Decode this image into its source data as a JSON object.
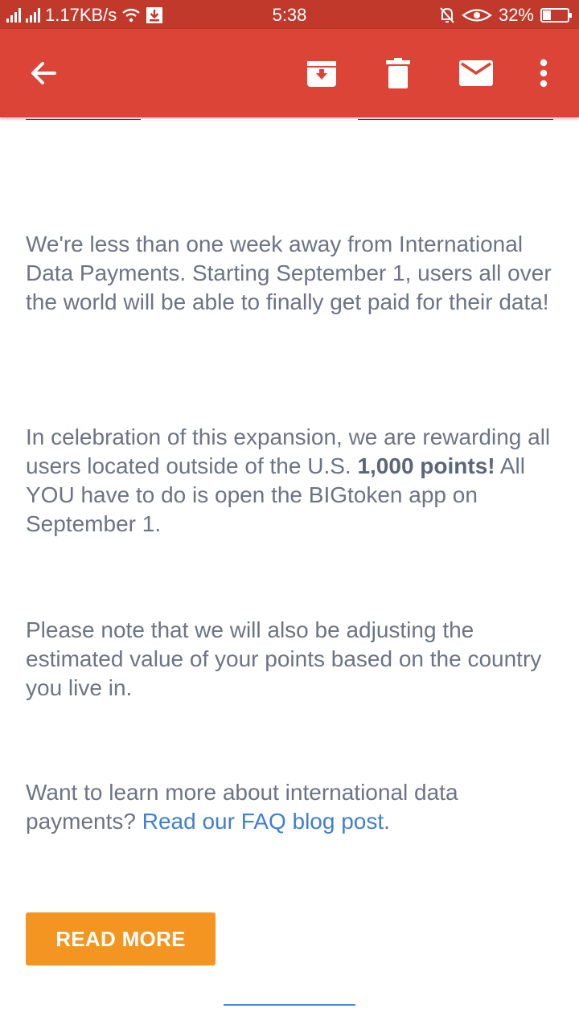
{
  "status_bar": {
    "network_speed": "1.17KB/s",
    "time": "5:38",
    "battery": "32%",
    "battery_level": 0.32,
    "icons": [
      "signal-icon",
      "signal-icon",
      "wifi-icon",
      "download-icon",
      "mute-icon",
      "eye-icon",
      "battery-icon"
    ]
  },
  "app_bar": {
    "color": "#db4437",
    "icons": [
      "back-arrow-icon",
      "archive-icon",
      "trash-icon",
      "mail-icon",
      "more-vert-icon"
    ]
  },
  "email": {
    "p1": "We're less than one week away from International Data Payments. Starting September 1, users all over the world will be able to finally get paid for their data!",
    "p2_text": "In celebration of this expansion, we are rewarding all users located outside of the U.S. ",
    "p2_bold": "1,000 points!",
    "p2_rest": " All YOU have to do is open the BIGtoken app on September 1.",
    "p3": "Please note that we will also be adjusting the estimated value of your points based on the country you live in.",
    "p4_text": "Want to learn more about international data payments? ",
    "p4_link": "Read our FAQ blog post",
    "p4_end": ".",
    "button_label": "READ MORE"
  }
}
